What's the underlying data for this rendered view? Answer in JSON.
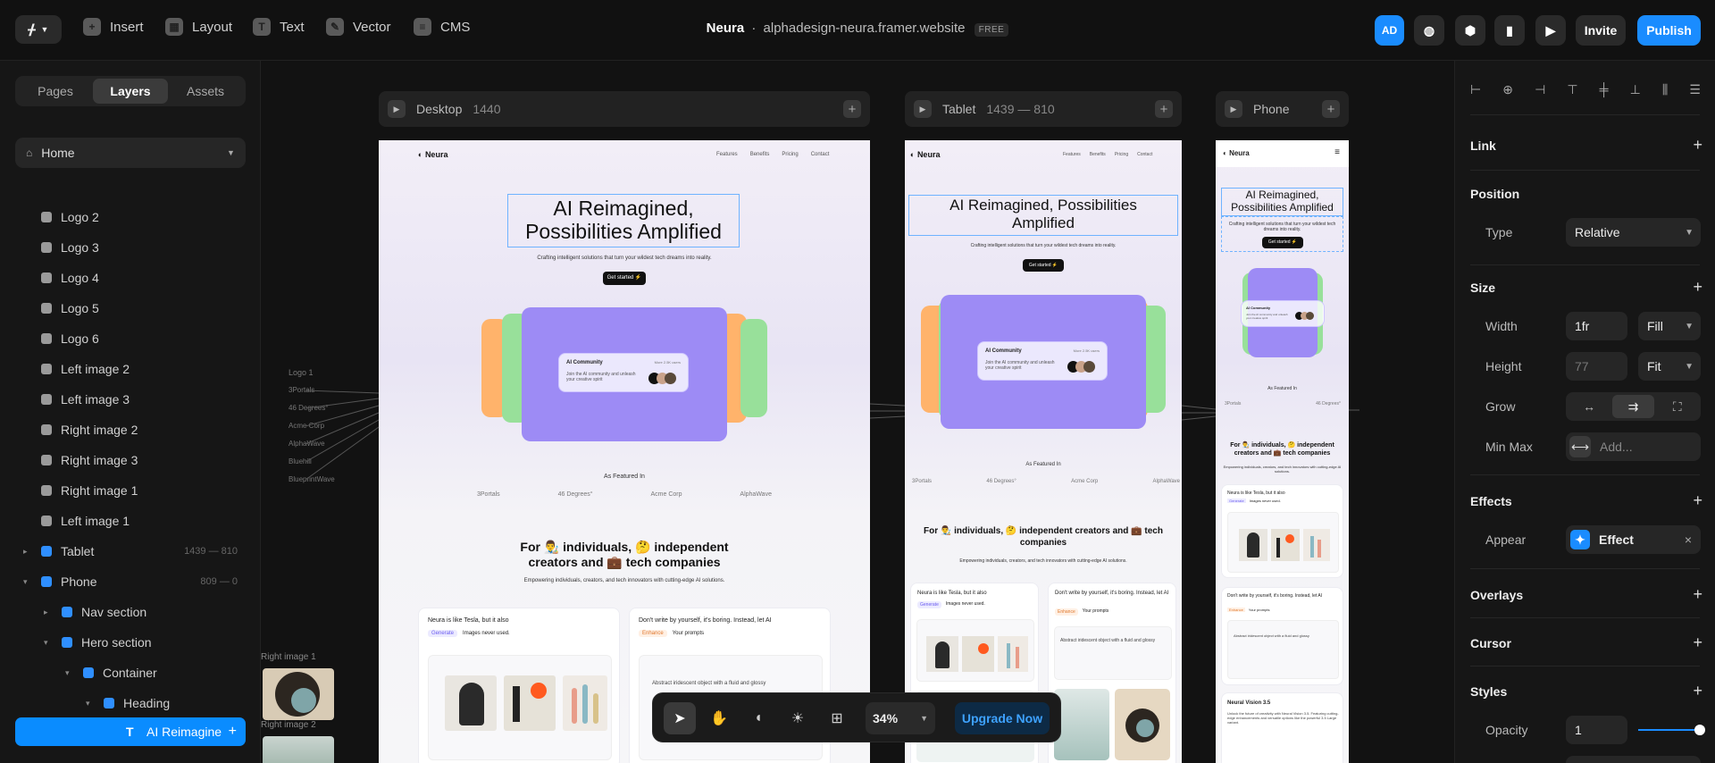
{
  "toolbar": {
    "insert": "Insert",
    "layout": "Layout",
    "text": "Text",
    "vector": "Vector",
    "cms": "CMS",
    "project_name": "Neura",
    "separator": "·",
    "site": "alphadesign-neura.framer.website",
    "plan": "FREE",
    "avatar": "AD",
    "invite": "Invite",
    "publish": "Publish"
  },
  "left": {
    "tabs": [
      "Pages",
      "Layers",
      "Assets"
    ],
    "active_tab": "Layers",
    "page": "Home",
    "layers": [
      {
        "label": "Logo 2"
      },
      {
        "label": "Logo 3"
      },
      {
        "label": "Logo 4"
      },
      {
        "label": "Logo 5"
      },
      {
        "label": "Logo 6"
      },
      {
        "label": "Left image 2"
      },
      {
        "label": "Left image 3"
      },
      {
        "label": "Right image 2"
      },
      {
        "label": "Right image 3"
      },
      {
        "label": "Right image 1"
      },
      {
        "label": "Left image 1"
      },
      {
        "label": "Tablet",
        "meta": "1439 — 810"
      },
      {
        "label": "Phone",
        "meta": "809 — 0"
      },
      {
        "label": "Nav section"
      },
      {
        "label": "Hero section"
      },
      {
        "label": "Container"
      },
      {
        "label": "Heading"
      }
    ],
    "selected": "AI Reimagine"
  },
  "canvas": {
    "desktop_label": "Desktop",
    "desktop_size": "1440",
    "tablet_label": "Tablet",
    "tablet_size": "1439 — 810",
    "phone_label": "Phone",
    "ghost": {
      "logo": "Logo 1",
      "items": [
        "3Portals",
        "46 Degrees°",
        "Acme Corp",
        "AlphaWave",
        "Bluehill",
        "BlueprintWave"
      ]
    },
    "right_image_1": "Right image 1",
    "right_image_2": "Right image 2",
    "site": {
      "brand": "Neura",
      "nav": [
        "Features",
        "Benefits",
        "Pricing",
        "Contact"
      ],
      "title_line1": "AI Reimagined,",
      "title_line2": "Possibilities Amplified",
      "tablet_title_line1": "AI Reimagined, Possibilities",
      "tablet_title_line2": "Amplified",
      "subtitle": "Crafting intelligent solutions that turn your wildest tech dreams into reality.",
      "cta": "Get started ⚡",
      "community_title": "AI Community",
      "community_more": "More 2.5K users",
      "community_text": "Join the AI community and unleash your creative spirit",
      "featured": "As Featured In",
      "brands": [
        "3Portals",
        "46 Degrees°",
        "Acme Corp",
        "AlphaWave"
      ],
      "section_title_1": "For 👨‍🎨 individuals, 🤔 independent",
      "section_title_2": "creators and 💼 tech companies",
      "tablet_section_1": "For 👨‍🎨 individuals, 🤔 independent creators and 💼 tech",
      "tablet_section_2": "companies",
      "section_sub": "Empowering individuals, creators, and tech innovators with cutting-edge AI solutions.",
      "card1_title": "Neura is like Tesla, but it also",
      "card1_tag": "Generate",
      "card1_text": "Images never used.",
      "card2_title": "Don't write by yourself, it's boring. Instead, let AI",
      "card2_tag": "Enhance",
      "card2_text": "Your prompts",
      "card2_body": "Abstract iridescent object with a fluid and glossy",
      "phone_card3_title": "Neural Vision 3.5",
      "phone_card3_text": "Unlock the future of creativity with Neural Vision 3.5. Featuring cutting-edge enhancements and versatile options like the powerful 3.5 Large variant."
    }
  },
  "bottom": {
    "zoom": "34%",
    "upgrade": "Upgrade Now"
  },
  "right": {
    "link": "Link",
    "position": "Position",
    "type_label": "Type",
    "type_value": "Relative",
    "size": "Size",
    "width_label": "Width",
    "width_value": "1fr",
    "width_mode": "Fill",
    "height_label": "Height",
    "height_value": "77",
    "height_mode": "Fit",
    "grow_label": "Grow",
    "minmax_label": "Min Max",
    "minmax_placeholder": "Add...",
    "effects": "Effects",
    "appear_label": "Appear",
    "effect_value": "Effect",
    "overlays": "Overlays",
    "cursor": "Cursor",
    "styles": "Styles",
    "opacity_label": "Opacity",
    "opacity_value": "1"
  },
  "colors": {
    "accent": "#0a8cff",
    "purple": "#9d8bf5",
    "selection": "#6fb3ff",
    "orange": "#ffb36b",
    "green": "#98e09a"
  }
}
